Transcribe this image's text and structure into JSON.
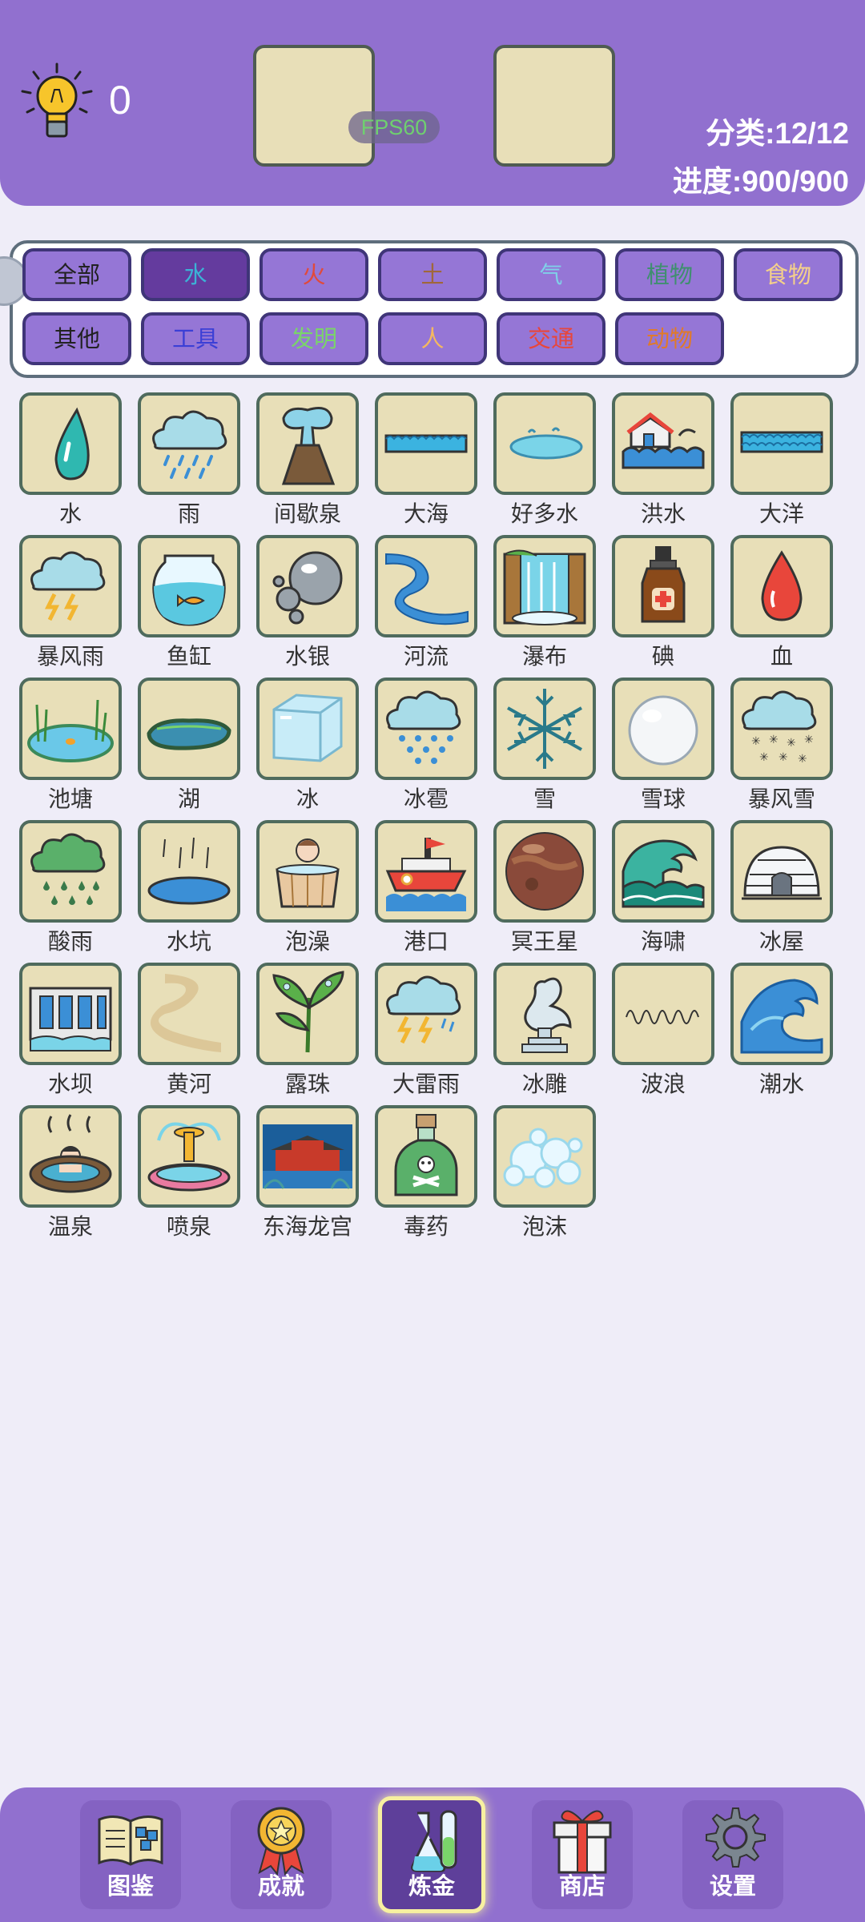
{
  "header": {
    "hint_count": "0",
    "fps": "FPS60",
    "category_progress": "分类:12/12",
    "overall_progress": "进度:900/900"
  },
  "categories": [
    {
      "label": "全部",
      "color": "#222222",
      "active": false
    },
    {
      "label": "水",
      "color": "#3bb3d6",
      "active": true
    },
    {
      "label": "火",
      "color": "#e14a3b",
      "active": false
    },
    {
      "label": "土",
      "color": "#a0673a",
      "active": false
    },
    {
      "label": "气",
      "color": "#7fd0e8",
      "active": false
    },
    {
      "label": "植物",
      "color": "#3f8f6f",
      "active": false
    },
    {
      "label": "食物",
      "color": "#f4d08a",
      "active": false
    },
    {
      "label": "其他",
      "color": "#222222",
      "active": false
    },
    {
      "label": "工具",
      "color": "#3b3fd6",
      "active": false
    },
    {
      "label": "发明",
      "color": "#7ad46a",
      "active": false
    },
    {
      "label": "人",
      "color": "#f4b860",
      "active": false
    },
    {
      "label": "交通",
      "color": "#e8463b",
      "active": false
    },
    {
      "label": "动物",
      "color": "#e07a2a",
      "active": false
    }
  ],
  "elements": [
    {
      "label": "水",
      "icon": "water-drop-icon"
    },
    {
      "label": "雨",
      "icon": "rain-cloud-icon"
    },
    {
      "label": "间歇泉",
      "icon": "geyser-icon"
    },
    {
      "label": "大海",
      "icon": "sea-icon"
    },
    {
      "label": "好多水",
      "icon": "puddle-icon"
    },
    {
      "label": "洪水",
      "icon": "flood-icon"
    },
    {
      "label": "大洋",
      "icon": "ocean-icon"
    },
    {
      "label": "暴风雨",
      "icon": "storm-icon"
    },
    {
      "label": "鱼缸",
      "icon": "fishbowl-icon"
    },
    {
      "label": "水银",
      "icon": "mercury-icon"
    },
    {
      "label": "河流",
      "icon": "river-icon"
    },
    {
      "label": "瀑布",
      "icon": "waterfall-icon"
    },
    {
      "label": "碘",
      "icon": "iodine-bottle-icon"
    },
    {
      "label": "血",
      "icon": "blood-drop-icon"
    },
    {
      "label": "池塘",
      "icon": "pond-icon"
    },
    {
      "label": "湖",
      "icon": "lake-icon"
    },
    {
      "label": "冰",
      "icon": "ice-cube-icon"
    },
    {
      "label": "冰雹",
      "icon": "hail-icon"
    },
    {
      "label": "雪",
      "icon": "snowflake-icon"
    },
    {
      "label": "雪球",
      "icon": "snowball-icon"
    },
    {
      "label": "暴风雪",
      "icon": "blizzard-icon"
    },
    {
      "label": "酸雨",
      "icon": "acid-rain-icon"
    },
    {
      "label": "水坑",
      "icon": "puddle-rain-icon"
    },
    {
      "label": "泡澡",
      "icon": "bath-icon"
    },
    {
      "label": "港口",
      "icon": "harbor-ship-icon"
    },
    {
      "label": "冥王星",
      "icon": "pluto-icon"
    },
    {
      "label": "海啸",
      "icon": "tsunami-icon"
    },
    {
      "label": "冰屋",
      "icon": "igloo-icon"
    },
    {
      "label": "水坝",
      "icon": "dam-icon"
    },
    {
      "label": "黄河",
      "icon": "yellow-river-icon"
    },
    {
      "label": "露珠",
      "icon": "dew-plant-icon"
    },
    {
      "label": "大雷雨",
      "icon": "thunderstorm-icon"
    },
    {
      "label": "冰雕",
      "icon": "ice-sculpture-icon"
    },
    {
      "label": "波浪",
      "icon": "wave-line-icon"
    },
    {
      "label": "潮水",
      "icon": "tide-icon"
    },
    {
      "label": "温泉",
      "icon": "hot-spring-icon"
    },
    {
      "label": "喷泉",
      "icon": "fountain-icon"
    },
    {
      "label": "东海龙宫",
      "icon": "dragon-palace-icon"
    },
    {
      "label": "毒药",
      "icon": "poison-bottle-icon"
    },
    {
      "label": "泡沫",
      "icon": "foam-bubbles-icon"
    }
  ],
  "nav": [
    {
      "label": "图鉴",
      "icon": "book-icon",
      "active": false
    },
    {
      "label": "成就",
      "icon": "medal-icon",
      "active": false
    },
    {
      "label": "炼金",
      "icon": "flask-icon",
      "active": true
    },
    {
      "label": "商店",
      "icon": "gift-icon",
      "active": false
    },
    {
      "label": "设置",
      "icon": "gear-icon",
      "active": false
    }
  ]
}
